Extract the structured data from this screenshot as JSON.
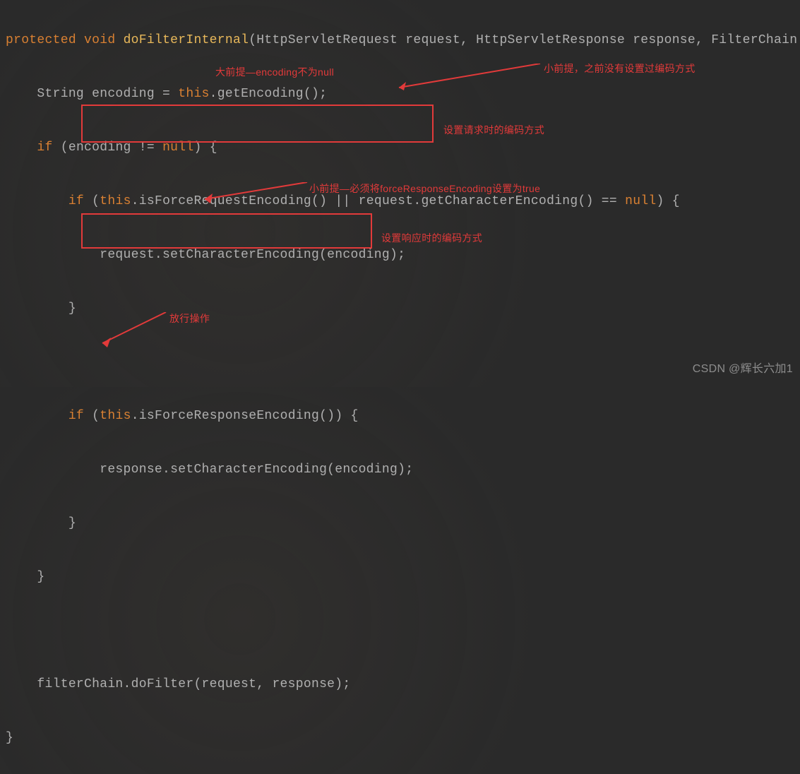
{
  "code": {
    "line1": {
      "kw1": "protected",
      "kw2": "void",
      "fn": "doFilterInternal",
      "rest": "(HttpServletRequest request, HttpServletResponse response, FilterChain"
    },
    "line2": {
      "pre": "    String encoding = ",
      "this": "this",
      "post": ".getEncoding();"
    },
    "line3": {
      "if": "if",
      "cond": " (encoding != ",
      "null": "null",
      "post": ") {"
    },
    "line4": {
      "pre": "        ",
      "if": "if",
      "open": " (",
      "this1": "this",
      "mid1": ".isForceRequestEncoding() || request.getCharacterEncoding() == ",
      "null": "null",
      "post": ") {"
    },
    "line5": {
      "text": "            request.setCharacterEncoding(encoding);"
    },
    "line6": {
      "text": "        }"
    },
    "line7": {
      "text": ""
    },
    "line8": {
      "pre": "        ",
      "if": "if",
      "open": " (",
      "this": "this",
      "post": ".isForceResponseEncoding()) {"
    },
    "line9": {
      "text": "            response.setCharacterEncoding(encoding);"
    },
    "line10": {
      "text": "        }"
    },
    "line11": {
      "text": "    }"
    },
    "line12": {
      "text": ""
    },
    "line13": {
      "text": "    filterChain.doFilter(request, response);"
    },
    "line14": {
      "text": "}"
    }
  },
  "annotations": {
    "a1": "大前提—encoding不为null",
    "a2": "小前提，之前没有设置过编码方式",
    "a3": "设置请求时的编码方式",
    "a4": "小前提—必须将forceResponseEncoding设置为true",
    "a5": "设置响应时的编码方式",
    "a6": "放行操作"
  },
  "watermark": "CSDN @辉长六加1"
}
